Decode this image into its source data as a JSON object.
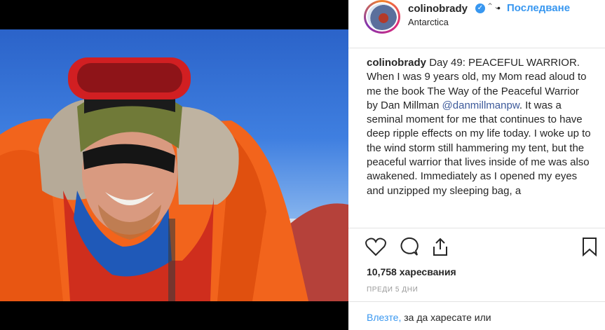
{
  "post": {
    "username": "colinobrady",
    "verified_icon": "verified-badge-icon",
    "follow_label": "Последване",
    "location": "Antarctica",
    "caption": {
      "user": "colinobrady",
      "text_before_mention": "Day 49: PEACEFUL WARRIOR. When I was 9 years old, my Mom read aloud to me the book The Way of the Peaceful Warrior by Dan Millman",
      "mention": "@danmillmanpw",
      "text_after_mention": ". It was a seminal moment for me that continues to have deep ripple effects on my life today. I woke up to the wind storm still hammering my tent, but the peaceful warrior that lives inside of me was also awakened. Immediately as I opened my eyes and unzipped my sleeping bag, a"
    },
    "likes": "10,758 харесвания",
    "time_ago": "ПРЕДИ 5 ДНИ",
    "login_link": "Влезте,",
    "login_text": " за да харесате или"
  },
  "icons": {
    "like": "heart-icon",
    "comment": "comment-icon",
    "share": "share-icon",
    "save": "bookmark-icon"
  },
  "colors": {
    "accent": "#3897f0",
    "text": "#262626"
  }
}
